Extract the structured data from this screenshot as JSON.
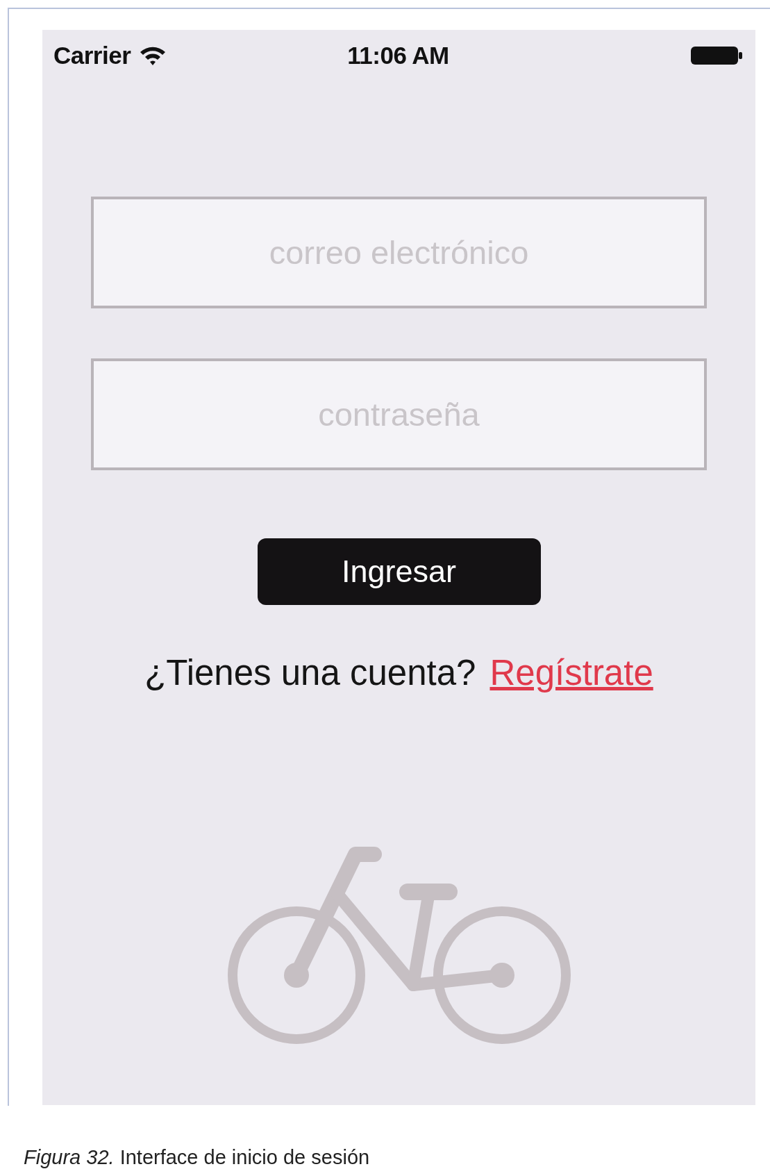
{
  "status_bar": {
    "carrier": "Carrier",
    "time": "11:06 AM"
  },
  "fields": [
    {
      "placeholder": "correo electrónico"
    },
    {
      "placeholder": "contraseña"
    }
  ],
  "login_button": {
    "label": "Ingresar"
  },
  "signup_prompt": {
    "text": "¿Tienes una cuenta?",
    "link": "Regístrate"
  },
  "caption": "*Figura 32.* Interface de inicio de sesión"
}
